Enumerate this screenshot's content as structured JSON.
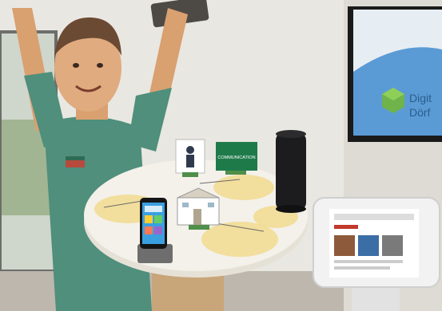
{
  "scene": {
    "sign_label": "COMMUNICATION",
    "monitor_brand_line1": "Digit",
    "monitor_brand_line2": "Dörf"
  },
  "colors": {
    "wall": "#e9e7e1",
    "floor": "#bdb7ad",
    "character_shirt": "#4f8f7c",
    "character_skin": "#d9a070",
    "table_top": "#f4f1ea",
    "table_accent": "#f1d98a",
    "speaker": "#1c1c1e",
    "sign_green": "#1f7a4a",
    "monitor_screen": "#e7eef3",
    "monitor_accent": "#5b9bd5"
  }
}
